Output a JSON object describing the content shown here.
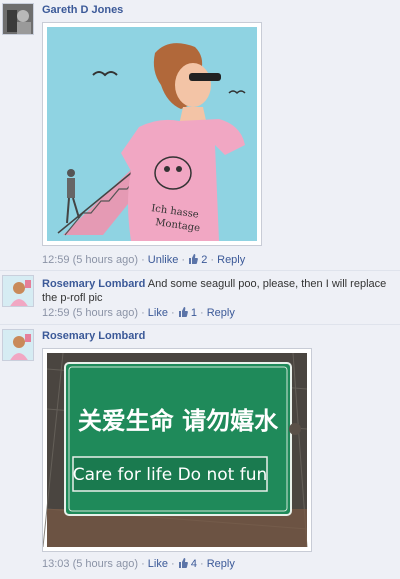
{
  "comments": [
    {
      "author": "Gareth D Jones",
      "text": "",
      "time": "12:59 (5 hours ago)",
      "sep1": " · ",
      "like_label": "Unlike",
      "sep2": " · ",
      "like_count": "2",
      "sep3": " · ",
      "reply_label": "Reply",
      "image_caption_line1": "Ich hasse",
      "image_caption_line2": "Montage"
    },
    {
      "author": "Rosemary Lombard",
      "text": "And some seagull poo, please, then I will replace the p-rofl pic",
      "time": "12:59 (5 hours ago)",
      "sep1": " · ",
      "like_label": "Like",
      "sep2": " · ",
      "like_count": "1",
      "sep3": " · ",
      "reply_label": "Reply"
    },
    {
      "author": "Rosemary Lombard",
      "text": "",
      "time": "13:03 (5 hours ago)",
      "sep1": " · ",
      "like_label": "Like",
      "sep2": " · ",
      "like_count": "4",
      "sep3": " · ",
      "reply_label": "Reply",
      "sign_chinese": "关爱生命 请勿嬉水",
      "sign_english": "Care for life  Do not fun"
    }
  ],
  "colors": {
    "link": "#3b5998",
    "meta": "#8b93a6",
    "background": "#eef0f6",
    "sign_green": "#1f8a5a"
  }
}
